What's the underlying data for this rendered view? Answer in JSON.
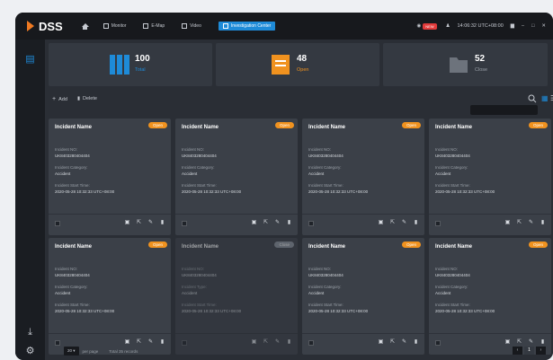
{
  "app": {
    "name": "DSS"
  },
  "nav": {
    "items": [
      {
        "label": "Monitor",
        "icon": "monitor-icon"
      },
      {
        "label": "E-Map",
        "icon": "map-icon"
      },
      {
        "label": "Video",
        "icon": "video-icon"
      },
      {
        "label": "Investigation Center",
        "icon": "investigation-icon",
        "active": true
      }
    ]
  },
  "topbar": {
    "badge": "NEW",
    "time": "14:06:32 UTC+08:00"
  },
  "stats": [
    {
      "value": "100",
      "label": "Total",
      "color": "#1e8bd8"
    },
    {
      "value": "48",
      "label": "Open",
      "color": "#f0921f"
    },
    {
      "value": "52",
      "label": "Close",
      "color": "#9aa0a8"
    }
  ],
  "toolbar": {
    "add_label": "Add",
    "delete_label": "Delete"
  },
  "search": {
    "placeholder": ""
  },
  "cards": [
    {
      "title": "Incident Name",
      "status": "Open",
      "no_label": "Incident NO:",
      "no": "UK8403280404404",
      "cat_label": "Incident Category:",
      "cat": "Accident",
      "start_label": "Incident Start Time:",
      "start": "2020-05-28 10:32:33 UTC+08:00"
    },
    {
      "title": "Incident Name",
      "status": "Open",
      "no_label": "Incident NO:",
      "no": "UK8403280404404",
      "cat_label": "Incident Category:",
      "cat": "Accident",
      "start_label": "Incident Start Time:",
      "start": "2020-05-28 10:32:33 UTC+08:00"
    },
    {
      "title": "Incident Name",
      "status": "Open",
      "no_label": "Incident NO:",
      "no": "UK8403280404404",
      "cat_label": "Incident Category:",
      "cat": "Accident",
      "start_label": "Incident Start Time:",
      "start": "2020-05-28 10:32:33 UTC+08:00"
    },
    {
      "title": "Incident Name",
      "status": "Open",
      "no_label": "Incident NO:",
      "no": "UK8403280404404",
      "cat_label": "Incident Category:",
      "cat": "Accident",
      "start_label": "Incident Start Time:",
      "start": "2020-05-28 10:32:33 UTC+08:00"
    },
    {
      "title": "Incident Name",
      "status": "Open",
      "no_label": "Incident NO:",
      "no": "UK8403280404404",
      "cat_label": "Incident Category:",
      "cat": "Accident",
      "start_label": "Incident Start Time:",
      "start": "2020-05-28 10:32:33 UTC+08:00"
    },
    {
      "title": "Incident Name",
      "status": "Close",
      "no_label": "Incident NO:",
      "no": "UK8403280404404",
      "cat_label": "Incident Type:",
      "cat": "Accident",
      "start_label": "Incident Start Time:",
      "start": "2020-05-28 10:32:33 UTC+08:00"
    },
    {
      "title": "Incident Name",
      "status": "Open",
      "no_label": "Incident NO:",
      "no": "UK8403280404404",
      "cat_label": "Incident Category:",
      "cat": "Accident",
      "start_label": "Incident Start Time:",
      "start": "2020-05-28 10:32:33 UTC+08:00"
    },
    {
      "title": "Incident Name",
      "status": "Open",
      "no_label": "Incident NO:",
      "no": "UK8403280404404",
      "cat_label": "Incident Category:",
      "cat": "Accident",
      "start_label": "Incident Start Time:",
      "start": "2020-05-28 10:32:33 UTC+08:00"
    }
  ],
  "footer": {
    "per_page_value": "20",
    "per_page_label": "per page",
    "total": "Total 35 records",
    "page": "1"
  }
}
